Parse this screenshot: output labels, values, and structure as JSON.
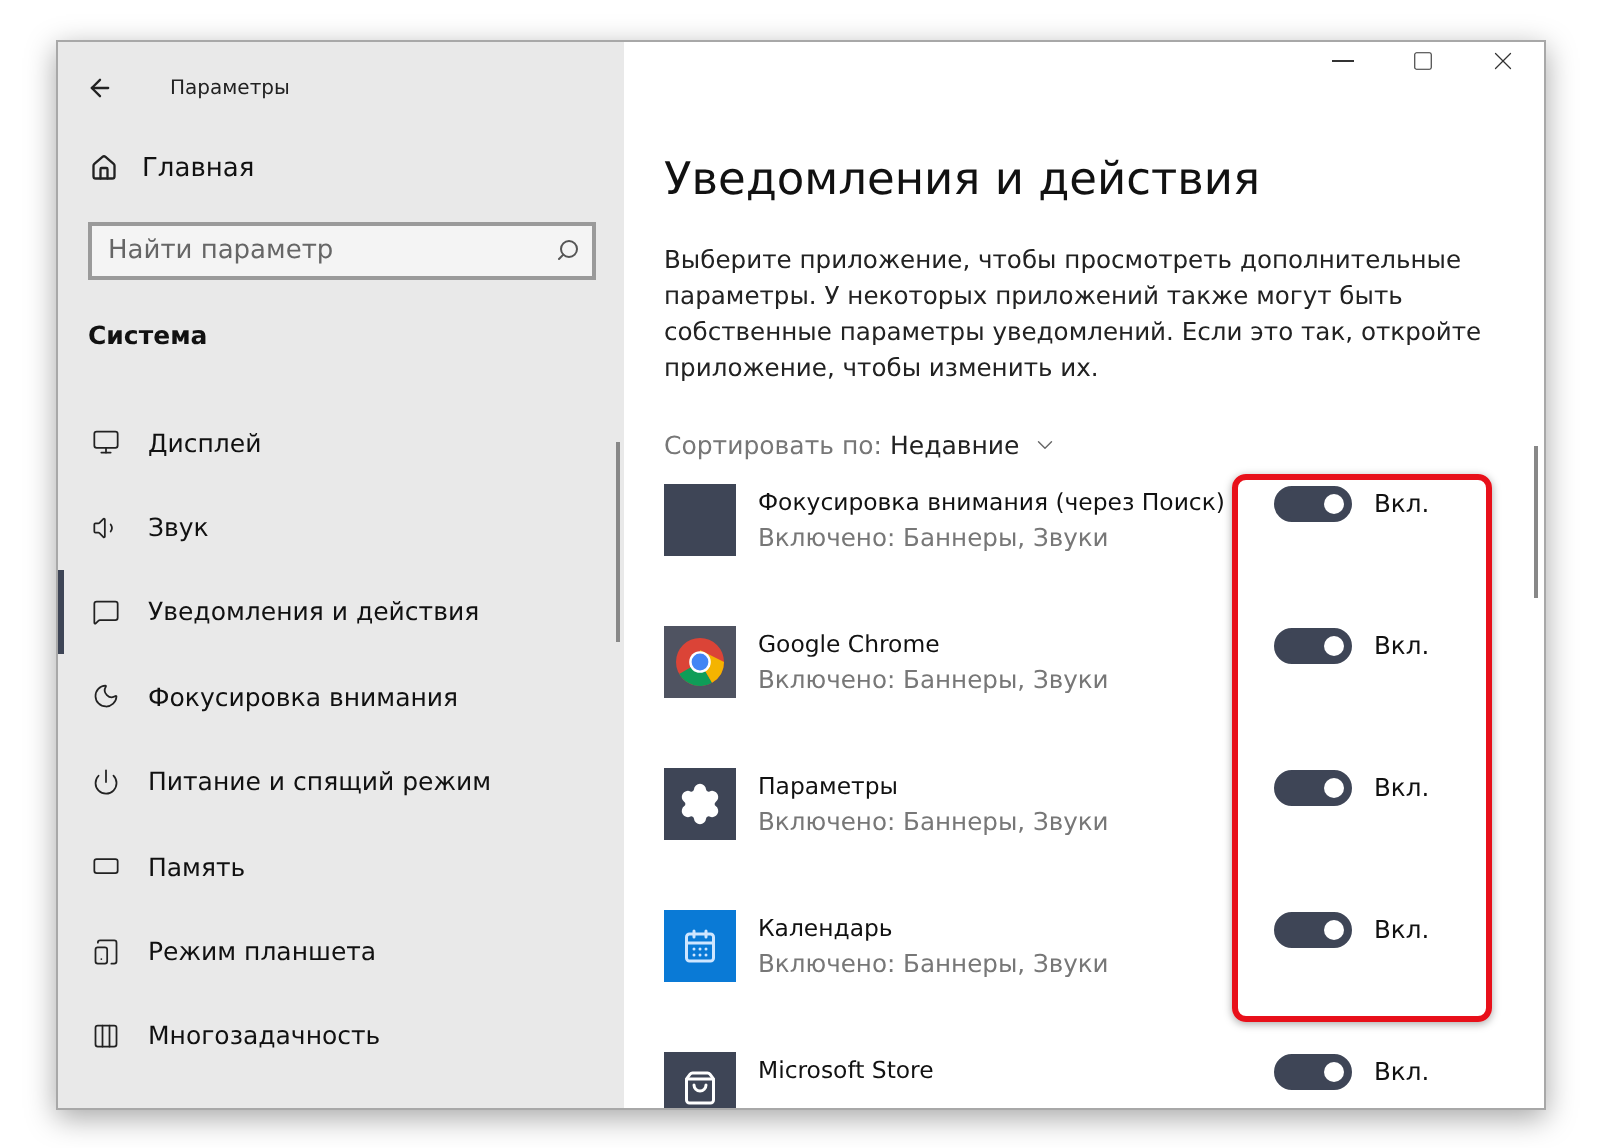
{
  "window": {
    "title": "Параметры"
  },
  "sidebar": {
    "home": "Главная",
    "search": {
      "placeholder": "Найти параметр"
    },
    "section": "Система",
    "items": [
      {
        "label": "Дисплей",
        "kind": "display",
        "selected": false
      },
      {
        "label": "Звук",
        "kind": "sound",
        "selected": false
      },
      {
        "label": "Уведомления и действия",
        "kind": "notifications",
        "selected": true
      },
      {
        "label": "Фокусировка внимания",
        "kind": "focus",
        "selected": false
      },
      {
        "label": "Питание и спящий режим",
        "kind": "power",
        "selected": false
      },
      {
        "label": "Память",
        "kind": "storage",
        "selected": false
      },
      {
        "label": "Режим планшета",
        "kind": "tablet",
        "selected": false
      },
      {
        "label": "Многозадачность",
        "kind": "multitask",
        "selected": false
      }
    ]
  },
  "content": {
    "title": "Уведомления и действия",
    "description": "Выберите приложение, чтобы просмотреть дополнительные параметры. У некоторых приложений также могут быть собственные параметры уведомлений. Если это так, откройте приложение, чтобы изменить их.",
    "sort": {
      "label": "Сортировать по:",
      "value": "Недавние"
    },
    "apps": [
      {
        "name": "Фокусировка внимания (через Поиск)",
        "status": "Включено: Баннеры, Звуки",
        "kind": "blank",
        "on": true,
        "toggle_label": "Вкл."
      },
      {
        "name": "Google Chrome",
        "status": "Включено: Баннеры, Звуки",
        "kind": "browser",
        "on": true,
        "toggle_label": "Вкл."
      },
      {
        "name": "Параметры",
        "status": "Включено: Баннеры, Звуки",
        "kind": "settings",
        "on": true,
        "toggle_label": "Вкл."
      },
      {
        "name": "Календарь",
        "status": "Включено: Баннеры, Звуки",
        "kind": "calendar",
        "on": true,
        "toggle_label": "Вкл."
      },
      {
        "name": "Microsoft Store",
        "kind": "store",
        "on": true,
        "toggle_label": "Вкл."
      }
    ]
  }
}
